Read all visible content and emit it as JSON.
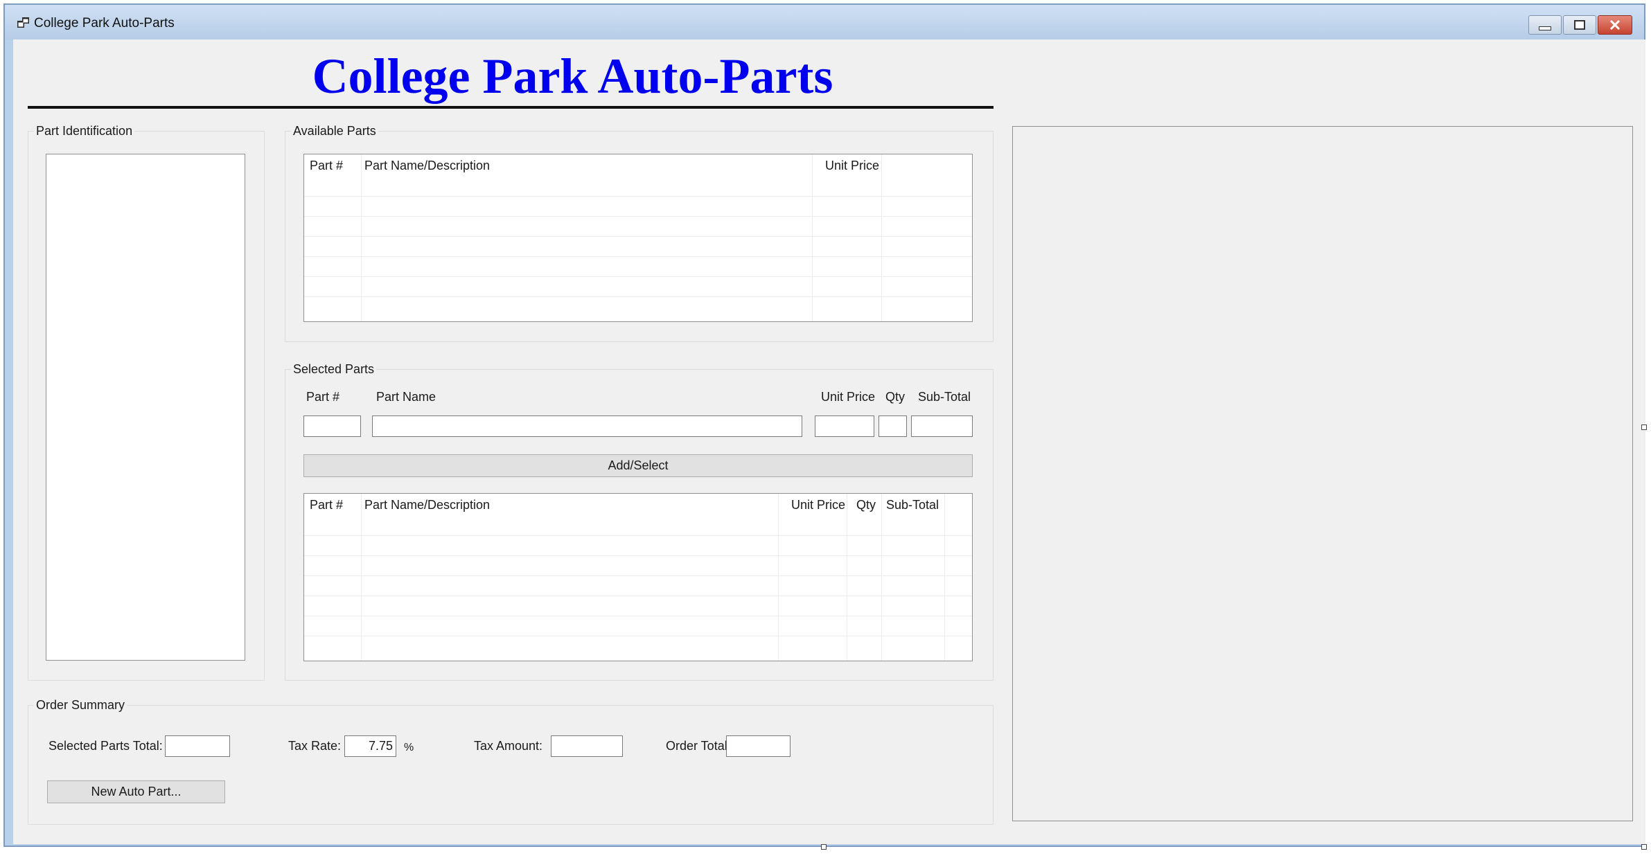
{
  "window": {
    "title": "College Park Auto-Parts"
  },
  "header": {
    "title": "College Park Auto-Parts",
    "title_color": "#0000ee"
  },
  "part_identification": {
    "label": "Part Identification"
  },
  "available_parts": {
    "label": "Available Parts",
    "columns": [
      "Part #",
      "Part Name/Description",
      "Unit Price"
    ]
  },
  "selected_parts": {
    "label": "Selected Parts",
    "field_labels": {
      "part_number": "Part #",
      "part_name": "Part Name",
      "unit_price": "Unit Price",
      "qty": "Qty",
      "sub_total": "Sub-Total"
    },
    "add_button": "Add/Select",
    "columns": [
      "Part #",
      "Part Name/Description",
      "Unit Price",
      "Qty",
      "Sub-Total"
    ]
  },
  "order_summary": {
    "label": "Order Summary",
    "selected_parts_total_label": "Selected Parts Total:",
    "tax_rate_label": "Tax Rate:",
    "tax_rate_value": "7.75",
    "percent_sign": "%",
    "tax_amount_label": "Tax Amount:",
    "order_total_label": "Order Total:",
    "new_part_button": "New Auto Part..."
  },
  "icons": {
    "app": "app-window-icon",
    "minimize": "minimize-icon",
    "maximize": "maximize-icon",
    "close": "close-icon"
  }
}
